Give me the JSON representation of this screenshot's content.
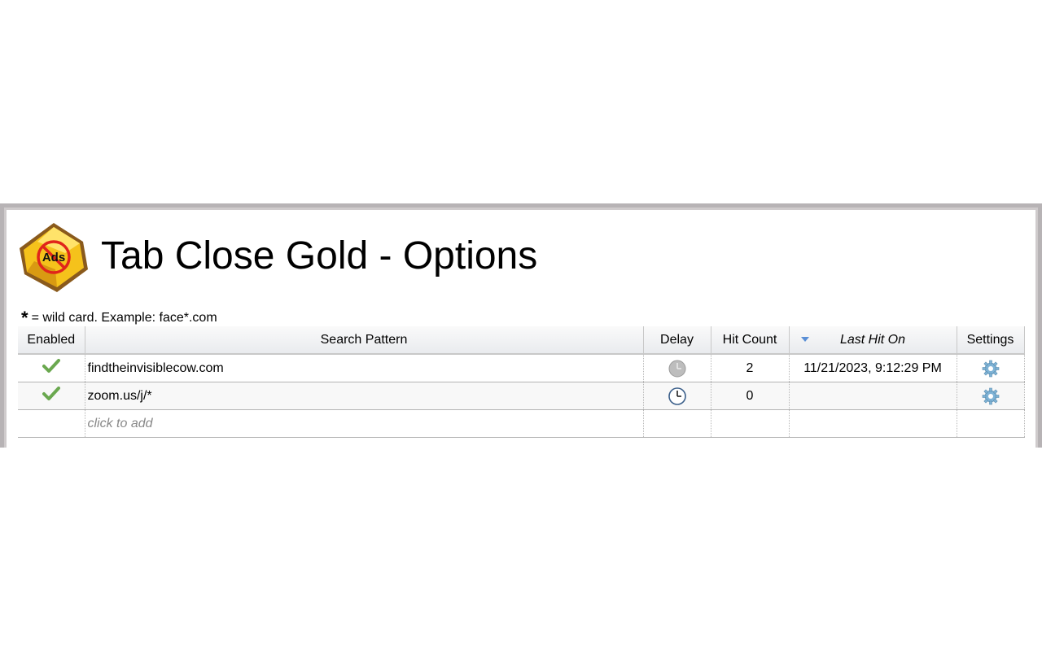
{
  "header": {
    "title": "Tab Close Gold - Options",
    "logo_text": "Ads"
  },
  "hint": {
    "star": "*",
    "text": "= wild card. Example: face*.com"
  },
  "table": {
    "columns": {
      "enabled": "Enabled",
      "pattern": "Search Pattern",
      "delay": "Delay",
      "hit_count": "Hit Count",
      "last_hit": "Last Hit On",
      "settings": "Settings"
    },
    "rows": [
      {
        "enabled": true,
        "pattern": "findtheinvisiblecow.com",
        "delay_icon": "clock-gray-icon",
        "hit_count": "2",
        "last_hit": "11/21/2023, 9:12:29 PM",
        "settings_icon": "gear-icon"
      },
      {
        "enabled": true,
        "pattern": "zoom.us/j/*",
        "delay_icon": "clock-color-icon",
        "hit_count": "0",
        "last_hit": "",
        "settings_icon": "gear-icon"
      }
    ],
    "add_placeholder": "click to add"
  },
  "colors": {
    "frame": "#b7b3b5",
    "sort_arrow": "#5a8fd6",
    "check": "#6aa84f",
    "gear": "#7fb3d6"
  }
}
